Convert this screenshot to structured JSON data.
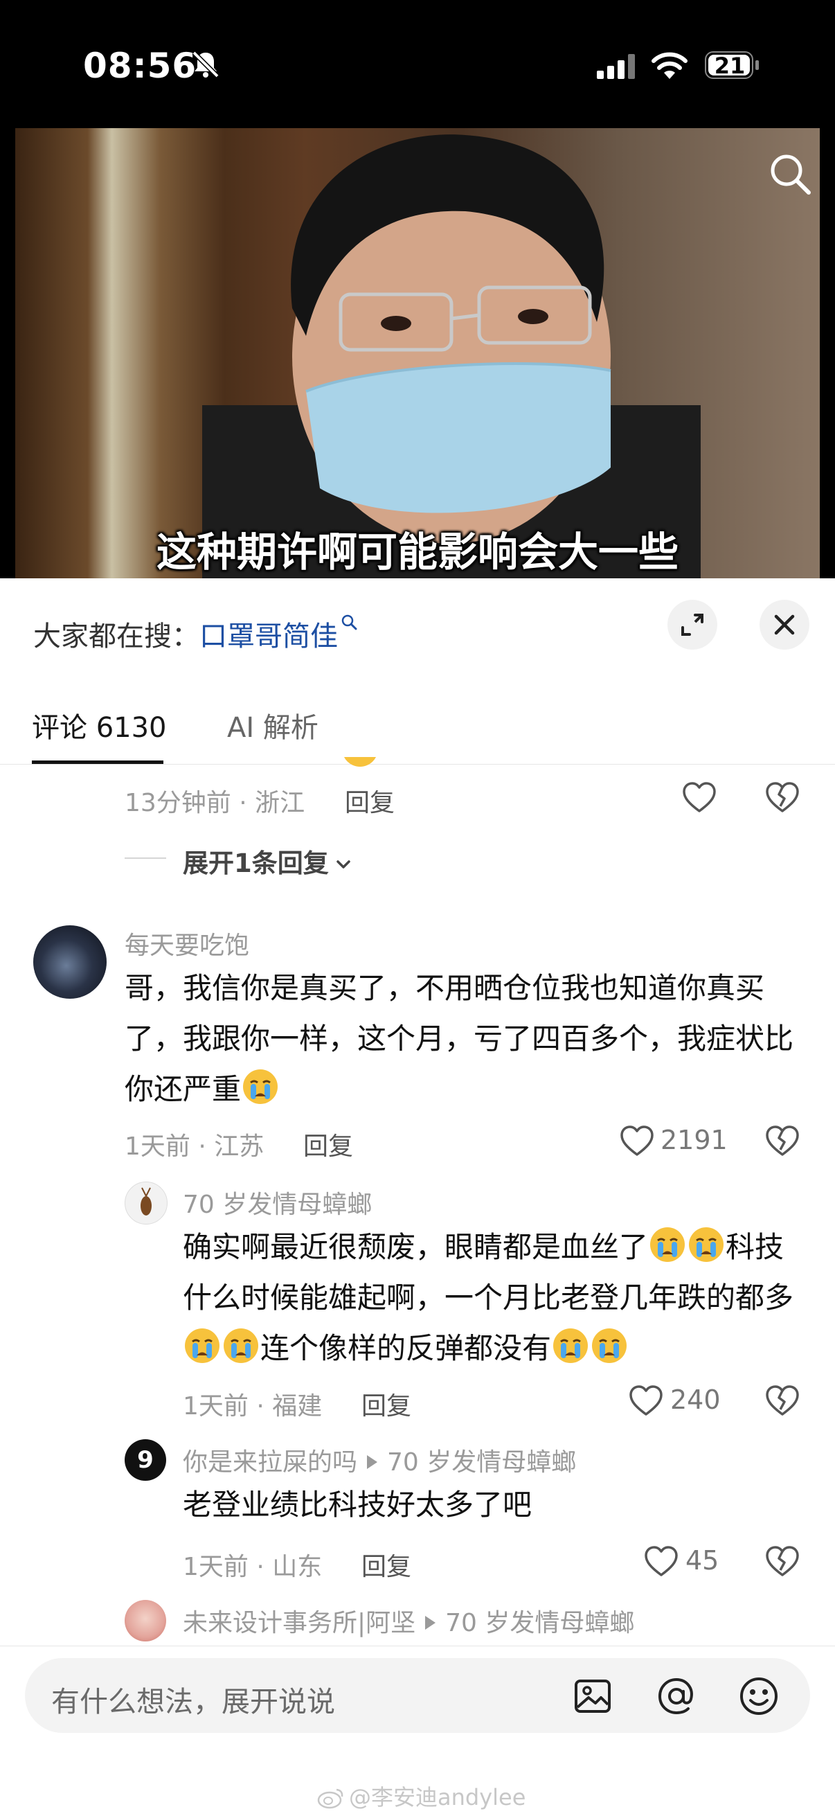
{
  "status_bar": {
    "time": "08:56",
    "battery": "21"
  },
  "video": {
    "subtitle": "这种期许啊可能影响会大一些"
  },
  "sheet": {
    "search_prefix": "大家都在搜：",
    "search_term": "口罩哥简佳",
    "tabs": [
      {
        "label": "评论 6130"
      },
      {
        "label": "AI 解析"
      }
    ]
  },
  "reply_label": "回复",
  "comments": {
    "top_partial": {
      "meta": "13分钟前 · 浙江"
    },
    "expand_replies": "展开1条回复",
    "main": {
      "username": "每天要吃饱",
      "text": "哥，我信你是真买了，不用晒仓位我也知道你真买了，我跟你一样，这个月，亏了四百多个，我症状比你还严重",
      "meta": "1天前 · 江苏",
      "likes": "2191"
    },
    "reply1": {
      "username": "70 岁发情母蟑螂",
      "text_a": "确实啊最近很颓废，眼睛都是血丝了",
      "text_b": "科技什么时候能雄起啊，一个月比老登几年跌的都多",
      "text_c": "连个像样的反弹都没有",
      "meta": "1天前 · 福建",
      "likes": "240"
    },
    "reply2": {
      "username": "你是来拉屎的吗",
      "reply_to": "70 岁发情母蟑螂",
      "avatar_text": "9",
      "text": "老登业绩比科技好太多了吧",
      "meta": "1天前 · 山东",
      "likes": "45"
    },
    "reply3": {
      "username": "未来设计事务所|阿坚",
      "reply_to": "70 岁发情母蟑螂"
    }
  },
  "composer": {
    "placeholder": "有什么想法，展开说说"
  },
  "watermark": "@李安迪andylee",
  "icons": [
    "bell-slash-icon",
    "signal-icon",
    "wifi-icon",
    "battery-icon",
    "search-icon",
    "expand-icon",
    "close-icon",
    "heart-icon",
    "broken-heart-icon",
    "chevron-down-icon",
    "crying-emoji-icon",
    "image-icon",
    "at-icon",
    "smiley-icon",
    "weibo-icon"
  ]
}
